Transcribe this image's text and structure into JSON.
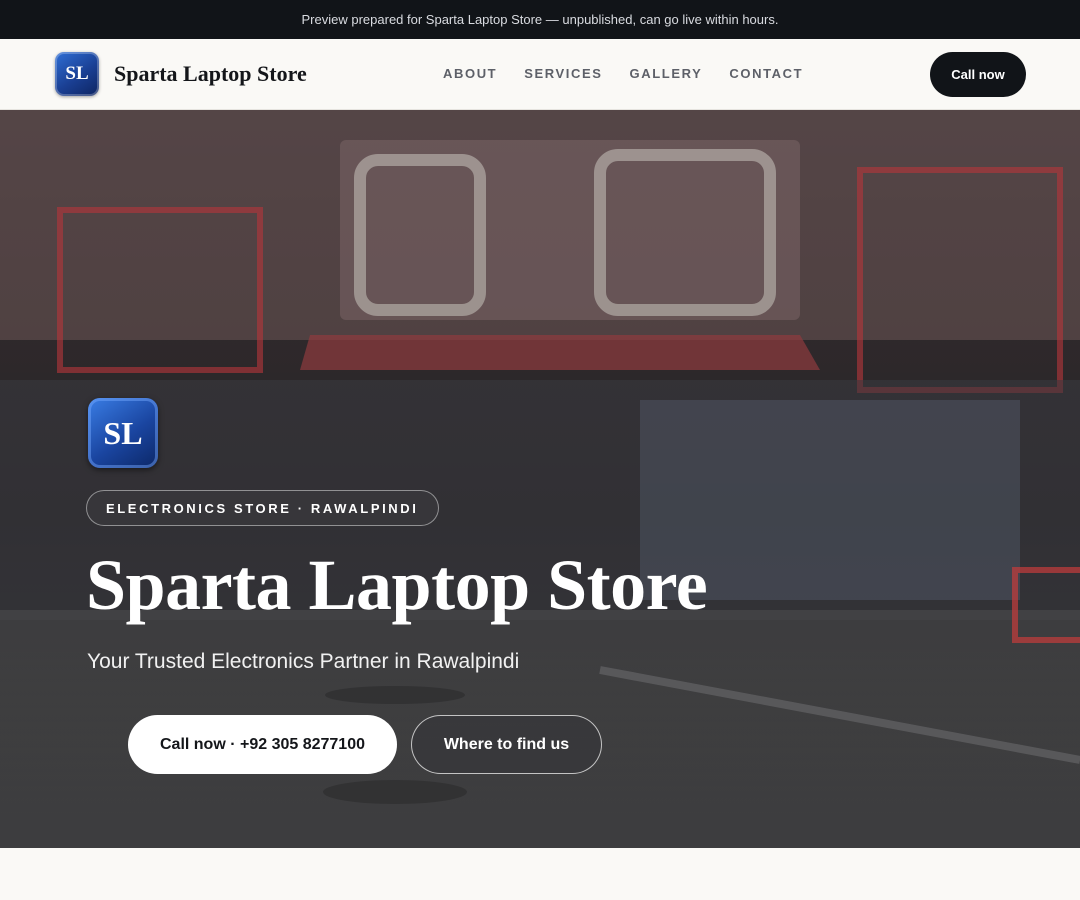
{
  "preview_bar": {
    "text": "Preview prepared for Sparta Laptop Store — unpublished, can go live within hours."
  },
  "nav": {
    "logo_initials": "SL",
    "brand": "Sparta Laptop Store",
    "links": [
      "ABOUT",
      "SERVICES",
      "GALLERY",
      "CONTACT"
    ],
    "call_label": "Call now"
  },
  "hero": {
    "logo_initials": "SL",
    "tag": "ELECTRONICS STORE · RAWALPINDI",
    "title": "Sparta Laptop Store",
    "subtitle": "Your Trusted Electronics Partner in Rawalpindi",
    "primary_cta": "Call now · +92 305 8277100",
    "secondary_cta": "Where to find us",
    "background_image": "electronics-storefront-photo"
  },
  "colors": {
    "dark": "#111418",
    "page_bg": "#faf9f6",
    "logo_blue": "#1a45a0",
    "nav_link": "#5d6068"
  }
}
